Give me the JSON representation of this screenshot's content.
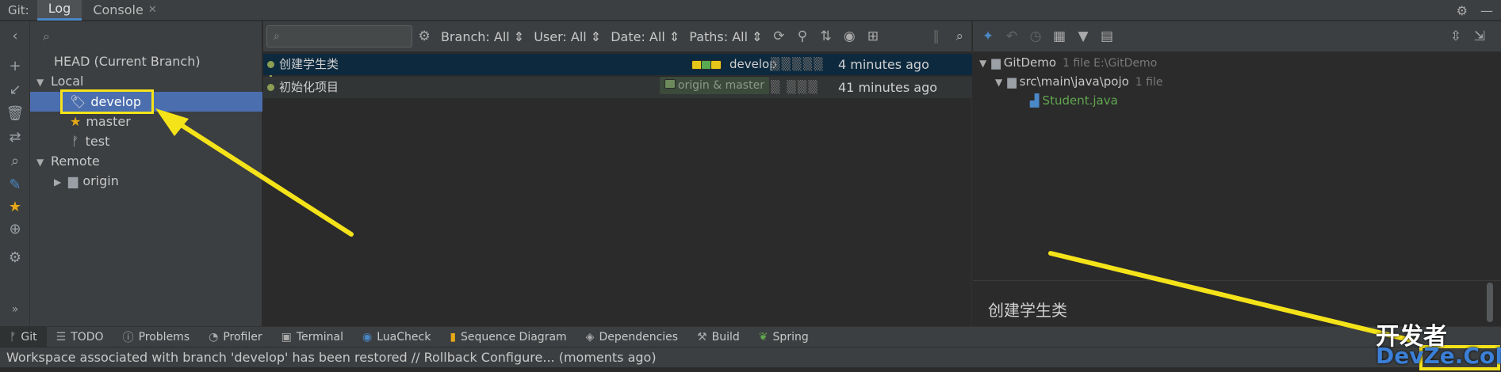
{
  "topbar": {
    "tool_window": "Git:",
    "tabs": [
      {
        "label": "Log",
        "active": true
      },
      {
        "label": "Console",
        "active": false
      }
    ]
  },
  "branches": {
    "search_placeholder": "",
    "head": "HEAD (Current Branch)",
    "local_label": "Local",
    "local": [
      {
        "name": "develop",
        "selected": true,
        "icon": "tag-icon"
      },
      {
        "name": "master",
        "icon": "star-icon"
      },
      {
        "name": "test",
        "icon": "branch-icon"
      }
    ],
    "remote_label": "Remote",
    "remote": [
      {
        "name": "origin",
        "icon": "folder-icon"
      }
    ]
  },
  "log": {
    "filters": {
      "branch": "Branch: All",
      "user": "User: All",
      "date": "Date: All",
      "paths": "Paths: All"
    },
    "commits": [
      {
        "message": "创建学生类",
        "refs": "develop",
        "time": "4 minutes ago",
        "selected": true
      },
      {
        "message": "初始化项目",
        "refs": "origin & master",
        "time": "41 minutes ago",
        "selected": false
      }
    ]
  },
  "details": {
    "root": "GitDemo",
    "root_meta": "1 file  E:\\GitDemo",
    "folder": "src\\main\\java\\pojo",
    "folder_meta": "1 file",
    "file": "Student.java",
    "commit_message": "创建学生类"
  },
  "bottombar": {
    "items": [
      {
        "label": "Git",
        "active": true,
        "icon": "branch-icon"
      },
      {
        "label": "TODO",
        "icon": "list-icon"
      },
      {
        "label": "Problems",
        "icon": "info-icon"
      },
      {
        "label": "Profiler",
        "icon": "profiler-icon"
      },
      {
        "label": "Terminal",
        "icon": "terminal-icon"
      },
      {
        "label": "LuaCheck",
        "icon": "lua-icon"
      },
      {
        "label": "Sequence Diagram",
        "icon": "diagram-icon"
      },
      {
        "label": "Dependencies",
        "icon": "layers-icon"
      },
      {
        "label": "Build",
        "icon": "hammer-icon"
      },
      {
        "label": "Spring",
        "icon": "leaf-icon"
      }
    ]
  },
  "statusbar": {
    "text": "Workspace associated with branch 'develop' has been restored // Rollback   Configure... (moments ago)"
  },
  "colors": {
    "accent": "#4a88c7",
    "selection": "#4b6eaf",
    "annotation": "#f5e31a"
  }
}
